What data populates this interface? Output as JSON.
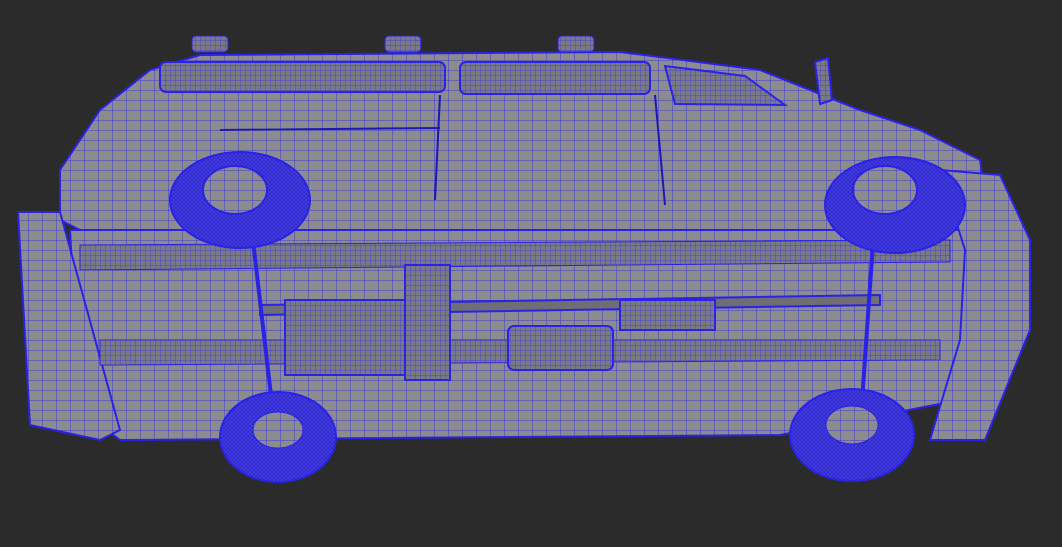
{
  "scene": {
    "subject": "van-underside-wireframe",
    "colors": {
      "background": "#2b2b2b",
      "surface": "#8c8c8e",
      "surface_dark": "#6e6e74",
      "wire": "#2a22e6",
      "wire_dense": "#3a2ff0"
    },
    "parts": [
      "body",
      "roof-lights",
      "side-mirror",
      "wheel-front-left",
      "wheel-front-right",
      "wheel-rear-left",
      "wheel-rear-right",
      "chassis-rails",
      "drive-shaft",
      "fuel-tank",
      "exhaust-box",
      "rear-bumper",
      "front-bumper"
    ]
  }
}
